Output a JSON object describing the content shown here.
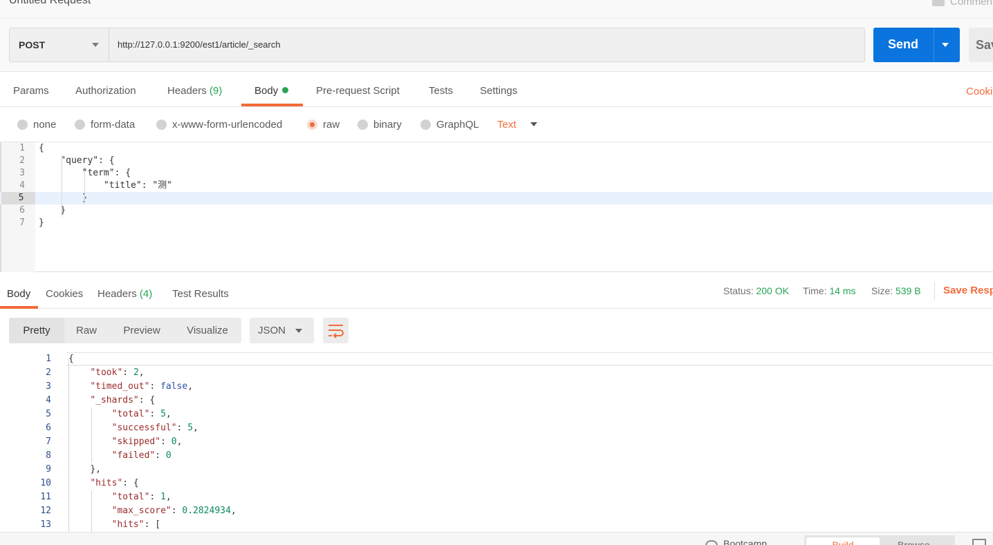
{
  "window": {
    "title": "Untitled Request",
    "comments_label": "Comments"
  },
  "request": {
    "method": "POST",
    "url": "http://127.0.0.1:9200/est1/article/_search",
    "send_label": "Send",
    "save_label": "Save"
  },
  "request_tabs": {
    "params": "Params",
    "authorization": "Authorization",
    "headers": "Headers",
    "headers_count": "(9)",
    "body": "Body",
    "prerequest": "Pre-request Script",
    "tests": "Tests",
    "settings": "Settings",
    "cookies": "Cookies"
  },
  "body_types": {
    "none": "none",
    "form_data": "form-data",
    "urlencoded": "x-www-form-urlencoded",
    "raw": "raw",
    "binary": "binary",
    "graphql": "GraphQL",
    "selected": "raw",
    "format": "Text"
  },
  "request_body": {
    "line_numbers": [
      "1",
      "2",
      "3",
      "4",
      "5",
      "6",
      "7"
    ],
    "lines": [
      "{",
      "    \"query\": {",
      "        \"term\": {",
      "            \"title\": \"测\"",
      "        }",
      "    }",
      "}"
    ],
    "active_line": "5"
  },
  "response_tabs": {
    "body": "Body",
    "cookies": "Cookies",
    "headers": "Headers",
    "headers_count": "(4)",
    "test_results": "Test Results"
  },
  "response_meta": {
    "status_label": "Status:",
    "status_value": "200 OK",
    "time_label": "Time:",
    "time_value": "14 ms",
    "size_label": "Size:",
    "size_value": "539 B",
    "save_response": "Save Response"
  },
  "response_view": {
    "pretty": "Pretty",
    "raw": "Raw",
    "preview": "Preview",
    "visualize": "Visualize",
    "format": "JSON",
    "wrap_icon": "wrap-lines-icon"
  },
  "response_body": {
    "lines": [
      {
        "n": "1",
        "indent": 0,
        "parts": [
          [
            "p",
            "{"
          ]
        ]
      },
      {
        "n": "2",
        "indent": 1,
        "parts": [
          [
            "k",
            "\"took\""
          ],
          [
            "p",
            ": "
          ],
          [
            "n",
            "2"
          ],
          [
            "p",
            ","
          ]
        ]
      },
      {
        "n": "3",
        "indent": 1,
        "parts": [
          [
            "k",
            "\"timed_out\""
          ],
          [
            "p",
            ": "
          ],
          [
            "b",
            "false"
          ],
          [
            "p",
            ","
          ]
        ]
      },
      {
        "n": "4",
        "indent": 1,
        "parts": [
          [
            "k",
            "\"_shards\""
          ],
          [
            "p",
            ": {"
          ]
        ]
      },
      {
        "n": "5",
        "indent": 2,
        "parts": [
          [
            "k",
            "\"total\""
          ],
          [
            "p",
            ": "
          ],
          [
            "n",
            "5"
          ],
          [
            "p",
            ","
          ]
        ]
      },
      {
        "n": "6",
        "indent": 2,
        "parts": [
          [
            "k",
            "\"successful\""
          ],
          [
            "p",
            ": "
          ],
          [
            "n",
            "5"
          ],
          [
            "p",
            ","
          ]
        ]
      },
      {
        "n": "7",
        "indent": 2,
        "parts": [
          [
            "k",
            "\"skipped\""
          ],
          [
            "p",
            ": "
          ],
          [
            "n",
            "0"
          ],
          [
            "p",
            ","
          ]
        ]
      },
      {
        "n": "8",
        "indent": 2,
        "parts": [
          [
            "k",
            "\"failed\""
          ],
          [
            "p",
            ": "
          ],
          [
            "n",
            "0"
          ]
        ]
      },
      {
        "n": "9",
        "indent": 1,
        "parts": [
          [
            "p",
            "},"
          ]
        ]
      },
      {
        "n": "10",
        "indent": 1,
        "parts": [
          [
            "k",
            "\"hits\""
          ],
          [
            "p",
            ": {"
          ]
        ]
      },
      {
        "n": "11",
        "indent": 2,
        "parts": [
          [
            "k",
            "\"total\""
          ],
          [
            "p",
            ": "
          ],
          [
            "n",
            "1"
          ],
          [
            "p",
            ","
          ]
        ]
      },
      {
        "n": "12",
        "indent": 2,
        "parts": [
          [
            "k",
            "\"max_score\""
          ],
          [
            "p",
            ": "
          ],
          [
            "n",
            "0.2824934"
          ],
          [
            "p",
            ","
          ]
        ]
      },
      {
        "n": "13",
        "indent": 2,
        "parts": [
          [
            "k",
            "\"hits\""
          ],
          [
            "p",
            ": ["
          ]
        ]
      }
    ]
  },
  "footer": {
    "bootcamp": "Bootcamp",
    "build": "Build",
    "browse": "Browse"
  },
  "colors": {
    "accent": "#f26b3a",
    "send": "#0b74de",
    "success": "#26a456"
  }
}
